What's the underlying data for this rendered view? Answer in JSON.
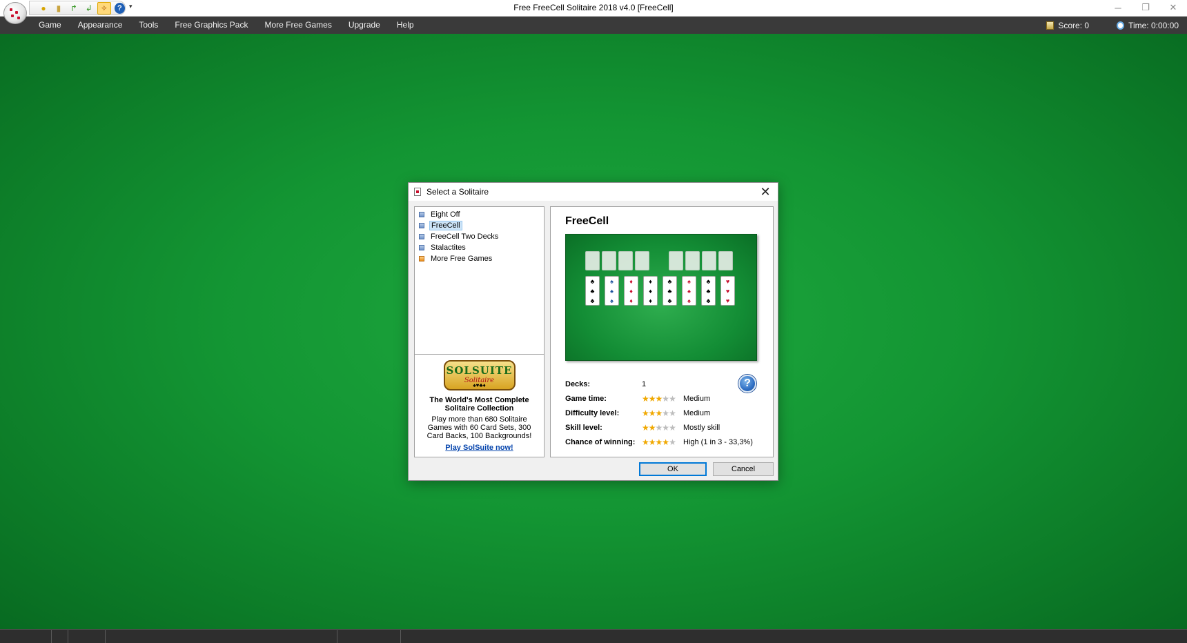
{
  "window": {
    "title": "Free FreeCell Solitaire 2018 v4.0  [FreeCell]",
    "controls": {
      "minimize": "─",
      "restore": "❐",
      "close": "✕"
    }
  },
  "quick_access": {
    "buttons": [
      {
        "icon": "coin-icon",
        "glyph": "●"
      },
      {
        "icon": "scroll-icon",
        "glyph": "▮"
      },
      {
        "icon": "redo-arrow-icon",
        "glyph": "↱"
      },
      {
        "icon": "undo-arrow-icon",
        "glyph": "↲"
      },
      {
        "icon": "hint-icon",
        "glyph": "✧"
      },
      {
        "icon": "help-icon",
        "glyph": "?"
      }
    ],
    "dropdown": "▾"
  },
  "menu": {
    "items": [
      "Game",
      "Appearance",
      "Tools",
      "Free Graphics Pack",
      "More Free Games",
      "Upgrade",
      "Help"
    ]
  },
  "status": {
    "score": "Score: 0",
    "time": "Time: 0:00:00"
  },
  "dialog": {
    "title": "Select a Solitaire",
    "close_glyph": "✕",
    "games": [
      {
        "label": "Eight Off",
        "selected": false,
        "icon": "game-icon"
      },
      {
        "label": "FreeCell",
        "selected": true,
        "icon": "game-icon"
      },
      {
        "label": "FreeCell Two Decks",
        "selected": false,
        "icon": "game-icon"
      },
      {
        "label": "Stalactites",
        "selected": false,
        "icon": "game-icon"
      },
      {
        "label": "More Free Games",
        "selected": false,
        "icon": "more-games-icon"
      }
    ],
    "promo": {
      "logo_text": "SOLSUITE",
      "logo_sub": "Solitaire",
      "logo_suits": "♠♥♣♦",
      "headline": "The World's Most Complete Solitaire Collection",
      "body": "Play more than 680 Solitaire Games with 60 Card Sets, 300 Card Backs, 100 Backgrounds!",
      "link": "Play SolSuite now!"
    },
    "selected_game": {
      "name": "FreeCell",
      "tableau_suits": [
        "♣",
        "♠",
        "♦",
        "♦",
        "♣",
        "♠",
        "♣",
        "♥"
      ],
      "tableau_colors": [
        "#000000",
        "#1b4f9c",
        "#c8102e",
        "#000000",
        "#000000",
        "#c8102e",
        "#000000",
        "#c8102e"
      ],
      "info": [
        {
          "label": "Decks:",
          "stars": null,
          "value": "1"
        },
        {
          "label": "Game time:",
          "stars": 3,
          "value": "Medium"
        },
        {
          "label": "Difficulty level:",
          "stars": 3,
          "value": "Medium"
        },
        {
          "label": "Skill level:",
          "stars": 2,
          "value": "Mostly skill"
        },
        {
          "label": "Chance of winning:",
          "stars": 4,
          "value": "High (1 in 3  -  33,3%)"
        }
      ],
      "star_glyph": "★",
      "star_total": 5
    },
    "help_glyph": "?",
    "ok_label": "OK",
    "cancel_label": "Cancel"
  },
  "colors": {
    "felt": "#139533",
    "menubar": "#3a3a3a",
    "star_on": "#f0a800",
    "link": "#0645ad"
  }
}
